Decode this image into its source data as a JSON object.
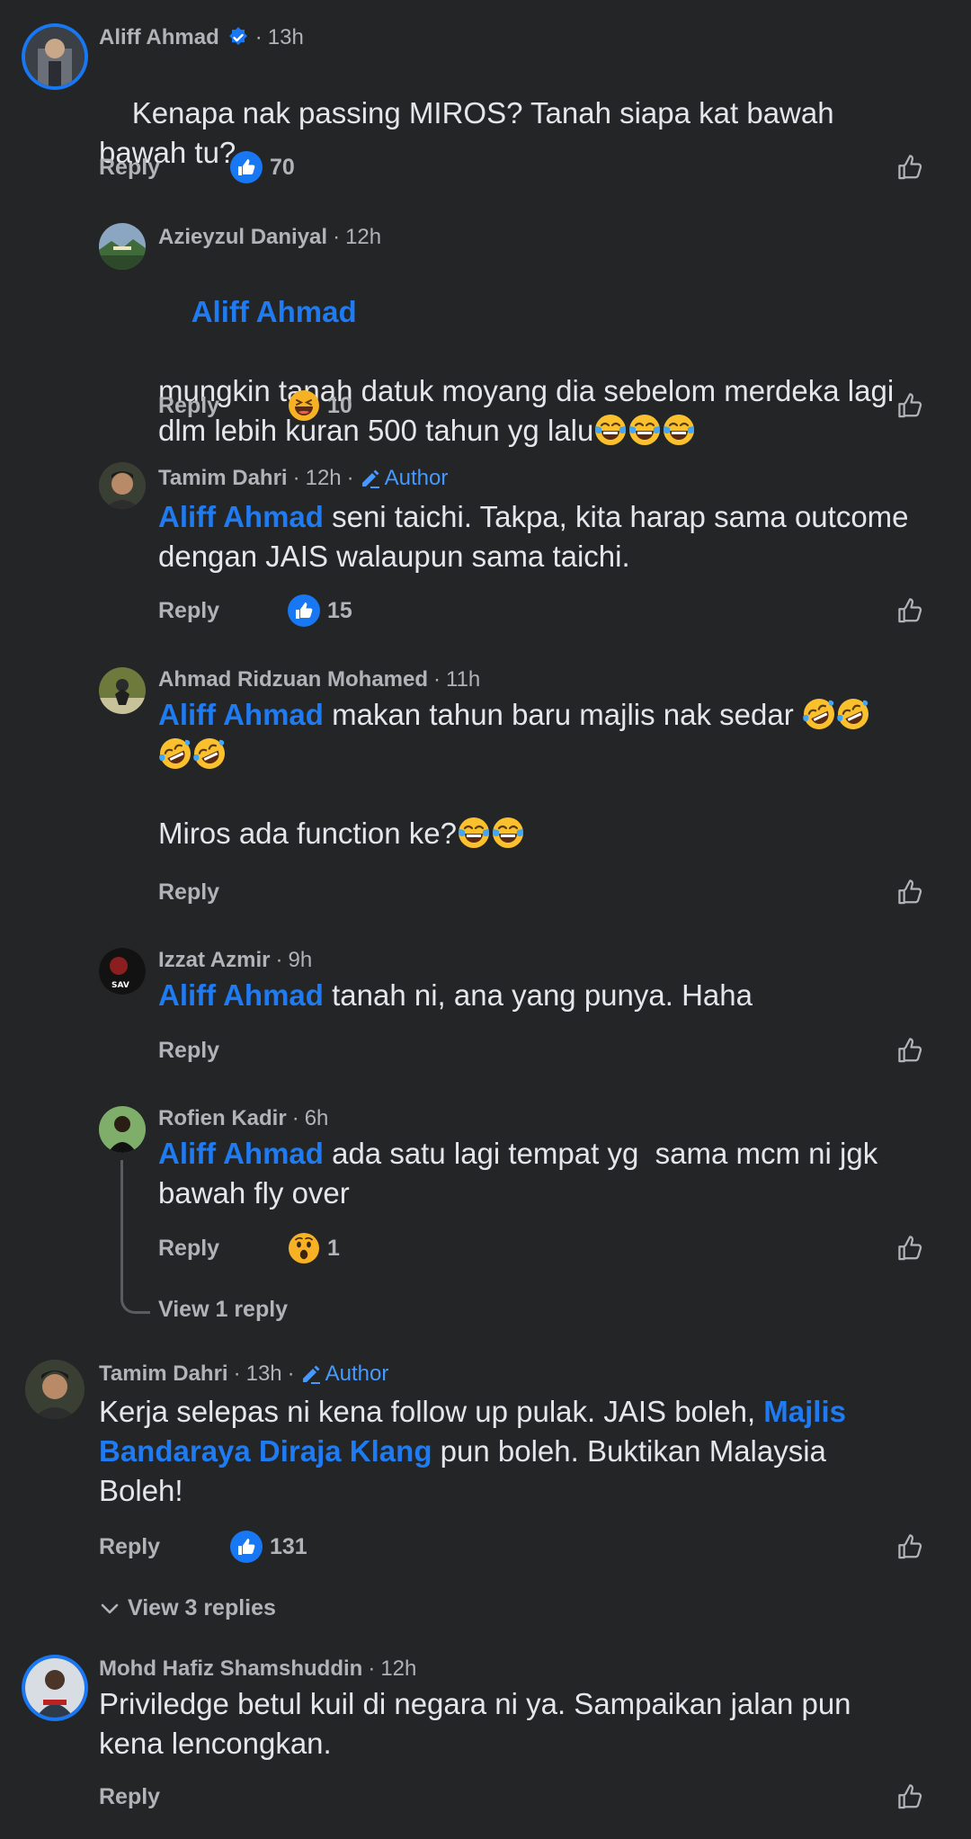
{
  "comments": [
    {
      "name": "Aliff Ahmad",
      "verified": true,
      "time": "13h",
      "text": "Kenapa nak passing MIROS? Tanah siapa kat bawah bawah tu?",
      "reply": "Reply",
      "reaction": "like",
      "count": "70"
    },
    {
      "name": "Azieyzul Daniyal",
      "time": "12h",
      "mention": "Aliff Ahmad",
      "text": "mungkin tanah datuk moyang dia sebelom merdeka lagi dlm lebih kuran 500 tahun yg lalu",
      "reply": "Reply",
      "reaction": "haha",
      "count": "10"
    },
    {
      "name": "Tamim Dahri",
      "time": "12h",
      "author": "Author",
      "mention": "Aliff Ahmad",
      "text": " seni taichi. Takpa, kita harap sama outcome dengan JAIS walaupun sama taichi.",
      "reply": "Reply",
      "reaction": "like",
      "count": "15"
    },
    {
      "name": "Ahmad Ridzuan Mohamed",
      "time": "11h",
      "mention": "Aliff Ahmad",
      "text": " makan tahun baru majlis nak sedar ",
      "text2": "Miros ada function ke?",
      "reply": "Reply"
    },
    {
      "name": "Izzat Azmir",
      "time": "9h",
      "mention": "Aliff Ahmad",
      "text": " tanah ni, ana yang punya. Haha",
      "reply": "Reply"
    },
    {
      "name": "Rofien Kadir",
      "time": "6h",
      "mention": "Aliff Ahmad",
      "text": " ada satu lagi tempat yg  sama mcm ni jgk bawah fly over",
      "reply": "Reply",
      "reaction": "wow",
      "count": "1",
      "view_replies": "View 1 reply"
    },
    {
      "name": "Tamim Dahri",
      "time": "13h",
      "author": "Author",
      "text": "Kerja selepas ni kena follow up pulak. JAIS boleh, ",
      "mention": "Majlis Bandaraya Diraja Klang",
      "text_after": " pun boleh. Buktikan Malaysia Boleh!",
      "reply": "Reply",
      "reaction": "like",
      "count": "131",
      "view_replies": "View 3 replies"
    },
    {
      "name": "Mohd Hafiz Shamshuddin",
      "time": "12h",
      "text": "Priviledge betul kuil di negara ni ya. Sampaikan jalan pun kena lencongkan.",
      "reply": "Reply"
    }
  ],
  "colors": {
    "background": "#242526",
    "mention": "#1f7bf2",
    "author": "#4599ff",
    "like": "#1877f2"
  },
  "icons": [
    "verified-icon",
    "pencil-icon",
    "like-reaction-icon",
    "haha-reaction-icon",
    "wow-reaction-icon",
    "thumbs-up-icon",
    "chevron-down-icon",
    "tears-of-joy-emoji",
    "rofl-emoji"
  ]
}
